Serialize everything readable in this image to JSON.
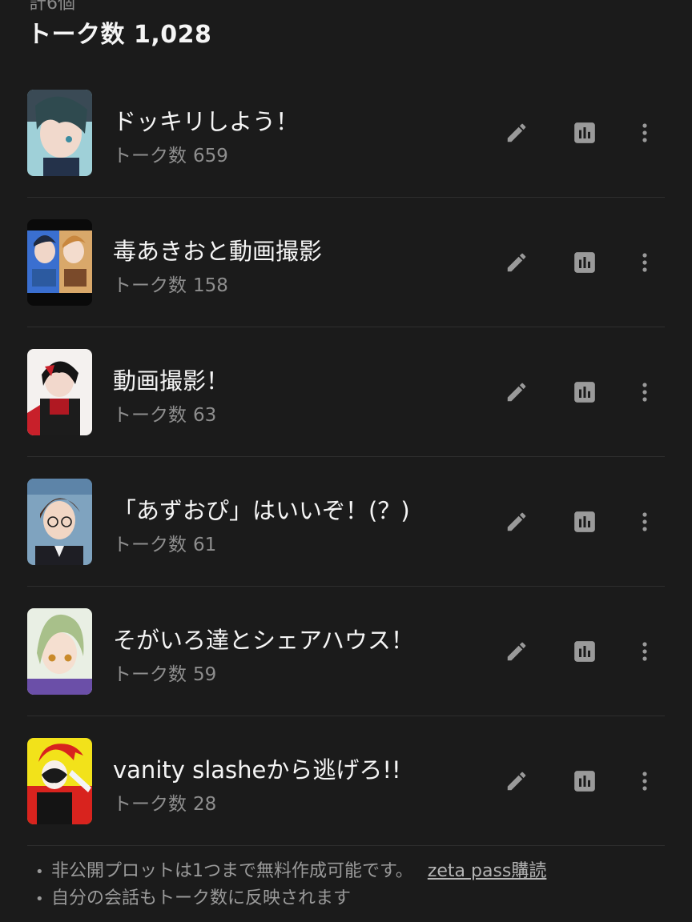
{
  "header": {
    "top_clip": "計6個",
    "total_label": "トーク数",
    "total_count": "1,028"
  },
  "colors": {
    "background": "#1b1b1b",
    "divider": "#2e2e2e",
    "icon": "#9a9a9a",
    "muted_text": "#8e8e8e"
  },
  "icons": {
    "edit": "pencil-icon",
    "stats": "bar-chart-icon",
    "more": "vertical-ellipsis-icon"
  },
  "plots": [
    {
      "title": "ドッキリしよう！",
      "count_label": "トーク数",
      "count": "659"
    },
    {
      "title": "毒あきおと動画撮影",
      "count_label": "トーク数",
      "count": "158"
    },
    {
      "title": "動画撮影！",
      "count_label": "トーク数",
      "count": "63"
    },
    {
      "title": "「あずおぴ」はいいぞ！(？)",
      "count_label": "トーク数",
      "count": "61"
    },
    {
      "title": "そがいろ達とシェアハウス！",
      "count_label": "トーク数",
      "count": "59"
    },
    {
      "title": "vanity slasheから逃げろ!!",
      "count_label": "トーク数",
      "count": "28"
    }
  ],
  "notes": [
    {
      "text": "非公開プロットは1つまで無料作成可能です。",
      "link": "zeta pass購読"
    },
    {
      "text": "自分の会話もトーク数に反映されます"
    }
  ]
}
